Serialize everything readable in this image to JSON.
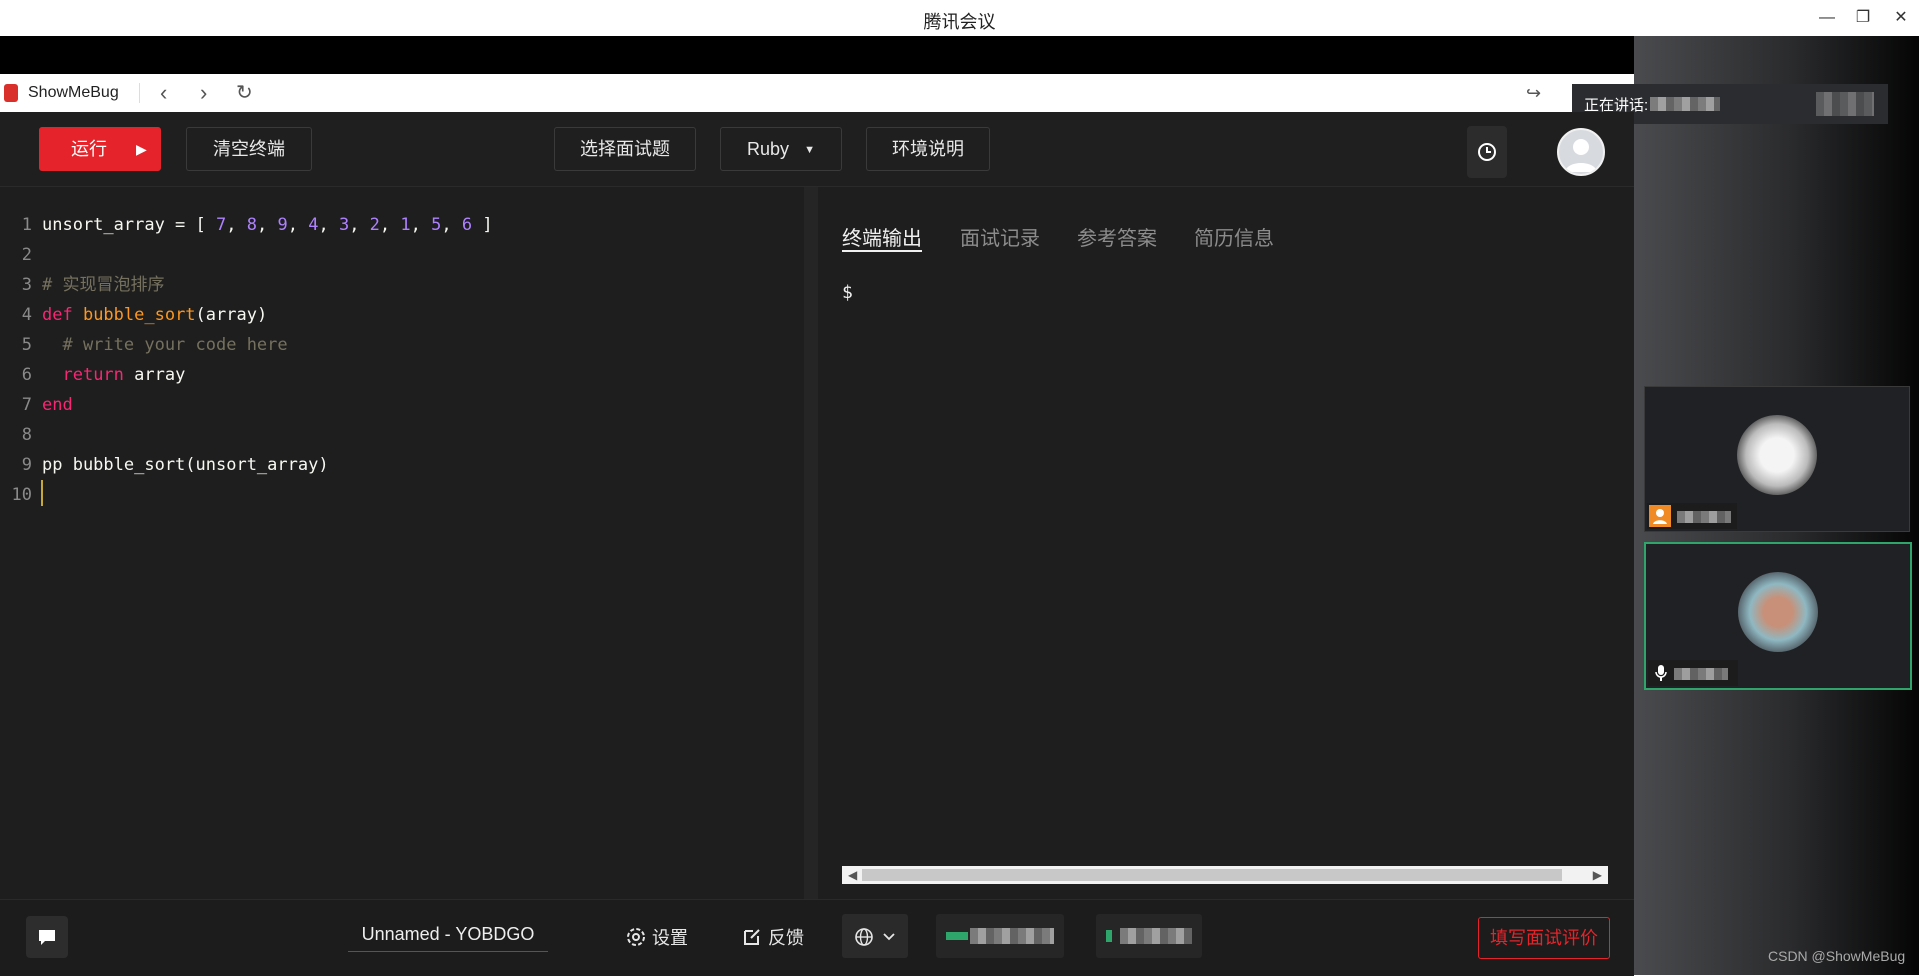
{
  "window": {
    "title": "腾讯会议",
    "minimize": "—",
    "restore": "❐",
    "close": "✕"
  },
  "browser": {
    "app_name": "ShowMeBug",
    "back": "‹",
    "forward": "›",
    "refresh": "↻",
    "share": "↪"
  },
  "meeting": {
    "speaking_label": "正在讲话:"
  },
  "toolbar": {
    "run_label": "运行",
    "clear_label": "清空终端",
    "select_question_label": "选择面试题",
    "language_label": "Ruby",
    "env_label": "环境说明"
  },
  "editor": {
    "line_numbers": [
      "1",
      "2",
      "3",
      "4",
      "5",
      "6",
      "7",
      "8",
      "9",
      "10"
    ],
    "lines": [
      [
        {
          "t": "unsort_array = [ ",
          "c": "plain"
        },
        {
          "t": "7",
          "c": "num"
        },
        {
          "t": ", ",
          "c": "plain"
        },
        {
          "t": "8",
          "c": "num"
        },
        {
          "t": ", ",
          "c": "plain"
        },
        {
          "t": "9",
          "c": "num"
        },
        {
          "t": ", ",
          "c": "plain"
        },
        {
          "t": "4",
          "c": "num"
        },
        {
          "t": ", ",
          "c": "plain"
        },
        {
          "t": "3",
          "c": "num"
        },
        {
          "t": ", ",
          "c": "plain"
        },
        {
          "t": "2",
          "c": "num"
        },
        {
          "t": ", ",
          "c": "plain"
        },
        {
          "t": "1",
          "c": "num"
        },
        {
          "t": ", ",
          "c": "plain"
        },
        {
          "t": "5",
          "c": "num"
        },
        {
          "t": ", ",
          "c": "plain"
        },
        {
          "t": "6",
          "c": "num"
        },
        {
          "t": " ]",
          "c": "plain"
        }
      ],
      [],
      [
        {
          "t": "# 实现冒泡排序",
          "c": "cmt"
        }
      ],
      [
        {
          "t": "def ",
          "c": "kw"
        },
        {
          "t": "bubble_sort",
          "c": "fn"
        },
        {
          "t": "(array)",
          "c": "plain"
        }
      ],
      [
        {
          "t": "  # write your code here",
          "c": "cmt"
        }
      ],
      [
        {
          "t": "  ",
          "c": "plain"
        },
        {
          "t": "return",
          "c": "kw"
        },
        {
          "t": " array",
          "c": "plain"
        }
      ],
      [
        {
          "t": "end",
          "c": "kw"
        }
      ],
      [],
      [
        {
          "t": "pp bubble_sort(unsort_array)",
          "c": "plain"
        }
      ],
      []
    ]
  },
  "terminal": {
    "tabs": [
      "终端输出",
      "面试记录",
      "参考答案",
      "简历信息"
    ],
    "prompt": "$",
    "scroll_left": "◀",
    "scroll_right": "▶"
  },
  "statusbar": {
    "filename": "Unnamed - YOBDGO",
    "settings_label": "设置",
    "feedback_label": "反馈",
    "evaluate_label": "填写面试评价"
  },
  "watermark": "CSDN @ShowMeBug",
  "colors": {
    "run": "#e5232a",
    "accent_green": "#2ea56a",
    "keyword": "#f92672",
    "function": "#fd971f",
    "number": "#ae81ff",
    "comment": "#75715e"
  }
}
